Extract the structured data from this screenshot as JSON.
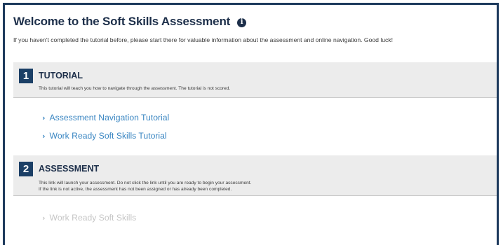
{
  "header": {
    "title": "Welcome to the Soft Skills Assessment",
    "info_icon": "info-circle-icon",
    "intro": "If you haven't completed the tutorial before, please start there for valuable information about the assessment and online navigation. Good luck!"
  },
  "sections": [
    {
      "number": "1",
      "heading": "TUTORIAL",
      "description": [
        "This tutorial will teach you how to navigate through the assessment. The tutorial is not scored."
      ],
      "links": [
        {
          "label": "Assessment Navigation Tutorial",
          "icon": "chevron-right-icon",
          "enabled": true
        },
        {
          "label": "Work Ready Soft Skills Tutorial",
          "icon": "chevron-right-icon",
          "enabled": true
        }
      ]
    },
    {
      "number": "2",
      "heading": "ASSESSMENT",
      "description": [
        "This link will launch your assessment. Do not click the link until you are ready to begin your assessment.",
        "If the link is not active, the assessment has not been assigned or has already been completed."
      ],
      "links": [
        {
          "label": "Work Ready Soft Skills",
          "icon": "chevron-right-icon",
          "enabled": false
        }
      ]
    }
  ],
  "colors": {
    "frame_border": "#1d3a5c",
    "title": "#1d2f4a",
    "badge": "#1b3f66",
    "section_bg": "#ececec",
    "link": "#3a86c2",
    "link_disabled": "#c6c6c6"
  }
}
